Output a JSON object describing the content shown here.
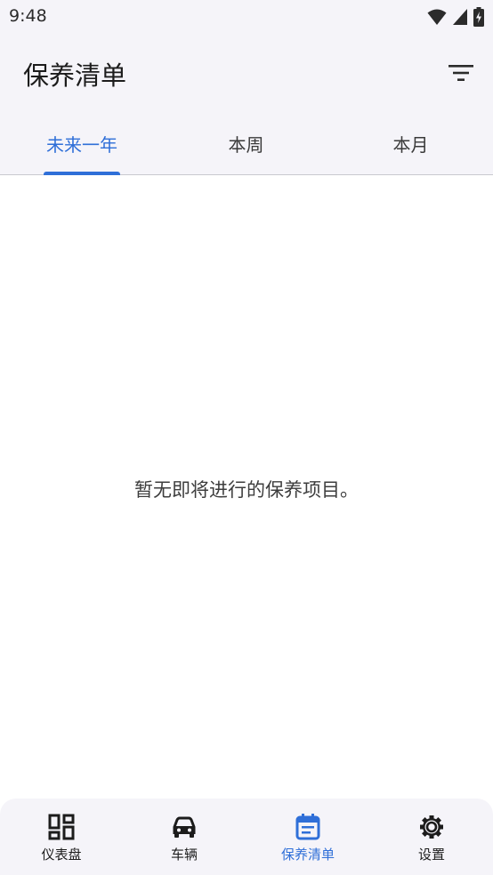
{
  "status_bar": {
    "time": "9:48",
    "icons": [
      "wifi-icon",
      "signal-icon",
      "battery-charging-icon"
    ]
  },
  "app_bar": {
    "title": "保养清单",
    "filter_icon": "filter-icon"
  },
  "tabs": [
    {
      "label": "未来一年",
      "active": true
    },
    {
      "label": "本周",
      "active": false
    },
    {
      "label": "本月",
      "active": false
    }
  ],
  "main": {
    "empty_message": "暂无即将进行的保养项目。"
  },
  "bottom_nav": {
    "items": [
      {
        "label": "仪表盘",
        "icon": "dashboard-icon",
        "active": false
      },
      {
        "label": "车辆",
        "icon": "car-icon",
        "active": false
      },
      {
        "label": "保养清单",
        "icon": "calendar-list-icon",
        "active": true
      },
      {
        "label": "设置",
        "icon": "gear-icon",
        "active": false
      }
    ]
  },
  "colors": {
    "accent": "#2f6fd8",
    "header_bg": "#f5f4f9",
    "body_bg": "#ffffff",
    "text": "#1f1f1f"
  }
}
